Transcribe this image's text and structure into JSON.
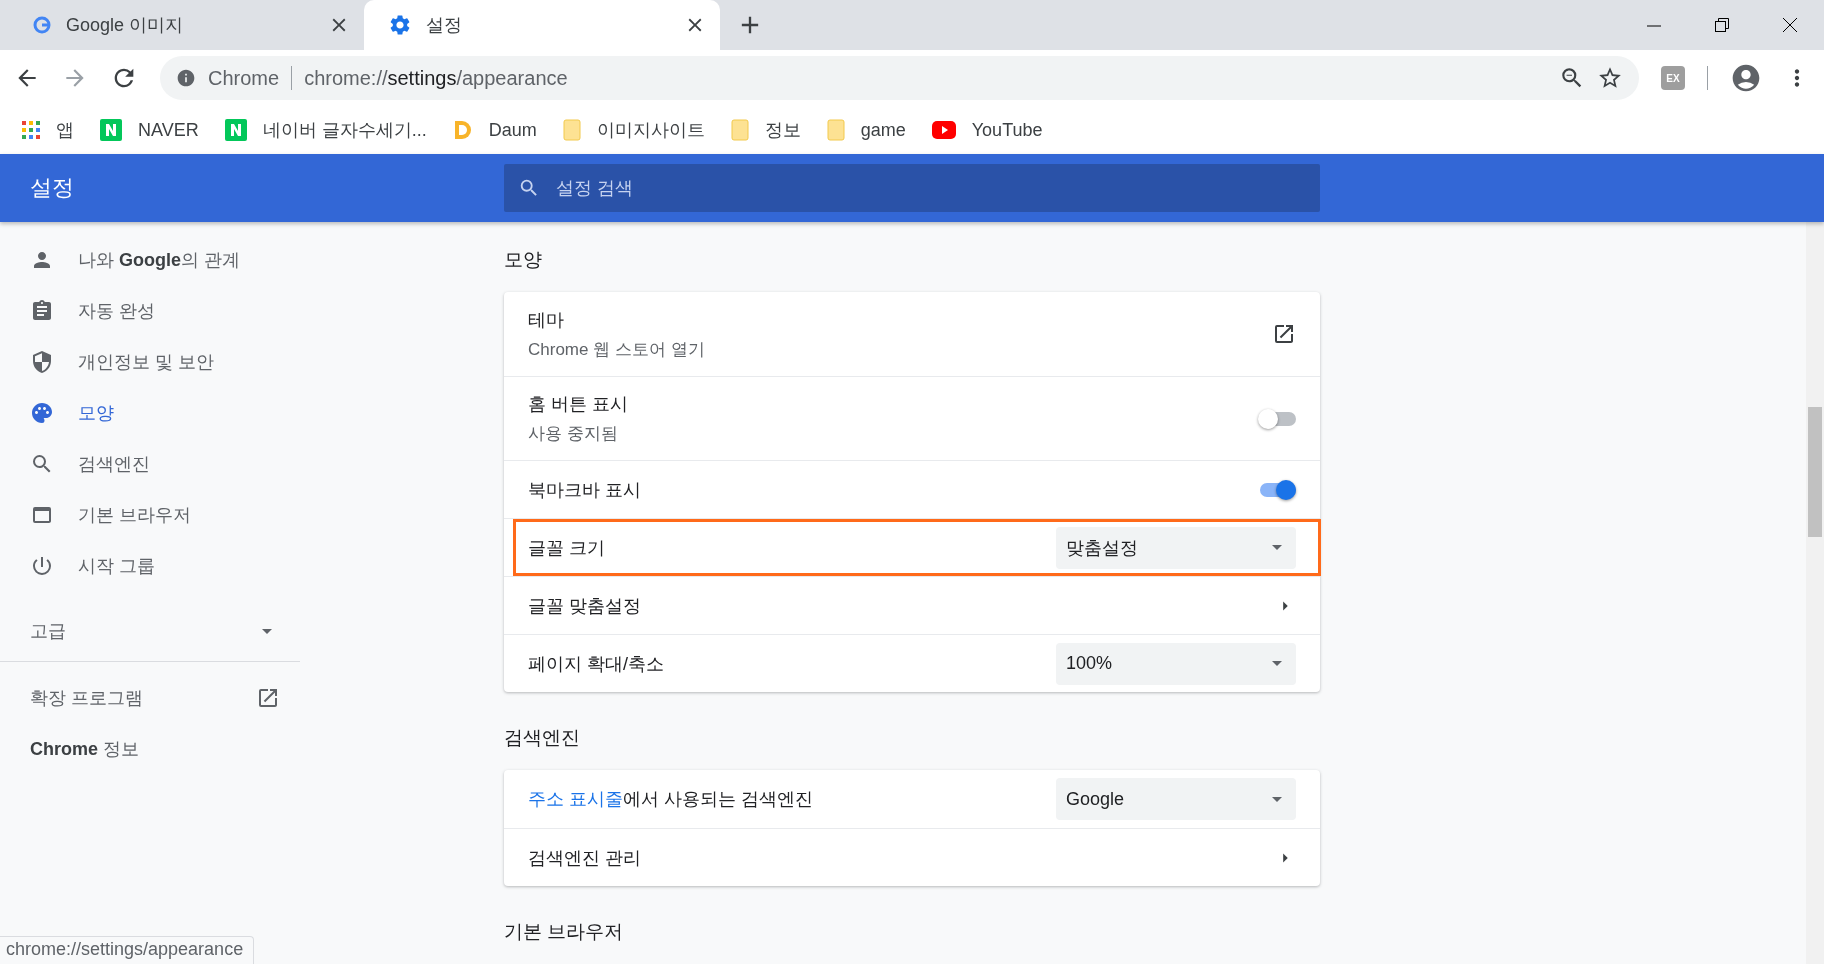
{
  "tabs": [
    {
      "kind": "google",
      "title": "Google 이미지",
      "selected": false
    },
    {
      "kind": "settings",
      "title": "설정",
      "selected": true
    }
  ],
  "omnibox": {
    "site": "Chrome",
    "url": "chrome://**settings**/appearance"
  },
  "bookmarks": [
    {
      "kind": "apps",
      "label": "앱"
    },
    {
      "kind": "naver",
      "label": "NAVER"
    },
    {
      "kind": "naver",
      "label": "네이버 글자수세기..."
    },
    {
      "kind": "daum",
      "label": "Daum"
    },
    {
      "kind": "folder",
      "label": "이미지사이트"
    },
    {
      "kind": "folder",
      "label": "정보"
    },
    {
      "kind": "folder",
      "label": "game"
    },
    {
      "kind": "youtube",
      "label": "YouTube"
    }
  ],
  "header": {
    "title": "설정",
    "search_placeholder": "설정 검색"
  },
  "sidebar": {
    "items": [
      {
        "label": "나와 **Google**의 관계",
        "selected": false
      },
      {
        "label": "자동 완성",
        "selected": false
      },
      {
        "label": "개인정보 및 보안",
        "selected": false
      },
      {
        "label": "모양",
        "selected": true
      },
      {
        "label": "검색엔진",
        "selected": false
      },
      {
        "label": "기본 브라우저",
        "selected": false
      },
      {
        "label": "시작 그룹",
        "selected": false
      }
    ],
    "advanced": {
      "label": "고급",
      "expanded": false
    },
    "extensions": "확장 프로그램",
    "about": "**Chrome** 정보"
  },
  "sections": [
    {
      "title": "모양",
      "rows": [
        {
          "kind": "link",
          "label": "테마",
          "sublabel": "Chrome 웹 스토어 열기",
          "highlighted": false
        },
        {
          "kind": "toggle",
          "label": "홈 버튼 표시",
          "sublabel": "사용 중지됨",
          "on": false,
          "highlighted": false
        },
        {
          "kind": "toggle",
          "label": "북마크바 표시",
          "on": true,
          "highlighted": false
        },
        {
          "kind": "select",
          "label": "글꼴 크기",
          "value": "맞춤설정",
          "highlighted": true
        },
        {
          "kind": "arrow",
          "label": "글꼴 맞춤설정",
          "highlighted": false
        },
        {
          "kind": "select",
          "label": "페이지 확대/축소",
          "value": "100%",
          "highlighted": false
        }
      ]
    },
    {
      "title": "검색엔진",
      "rows": [
        {
          "kind": "select",
          "link": "주소 표시줄",
          "label": "에서 사용되는 검색엔진",
          "value": "Google",
          "highlighted": false
        },
        {
          "kind": "arrow",
          "label": "검색엔진 관리",
          "highlighted": false
        }
      ]
    },
    {
      "title": "기본 브라우저"
    }
  ],
  "extension_badge": "EX",
  "status_bar": "chrome://settings/appearance"
}
